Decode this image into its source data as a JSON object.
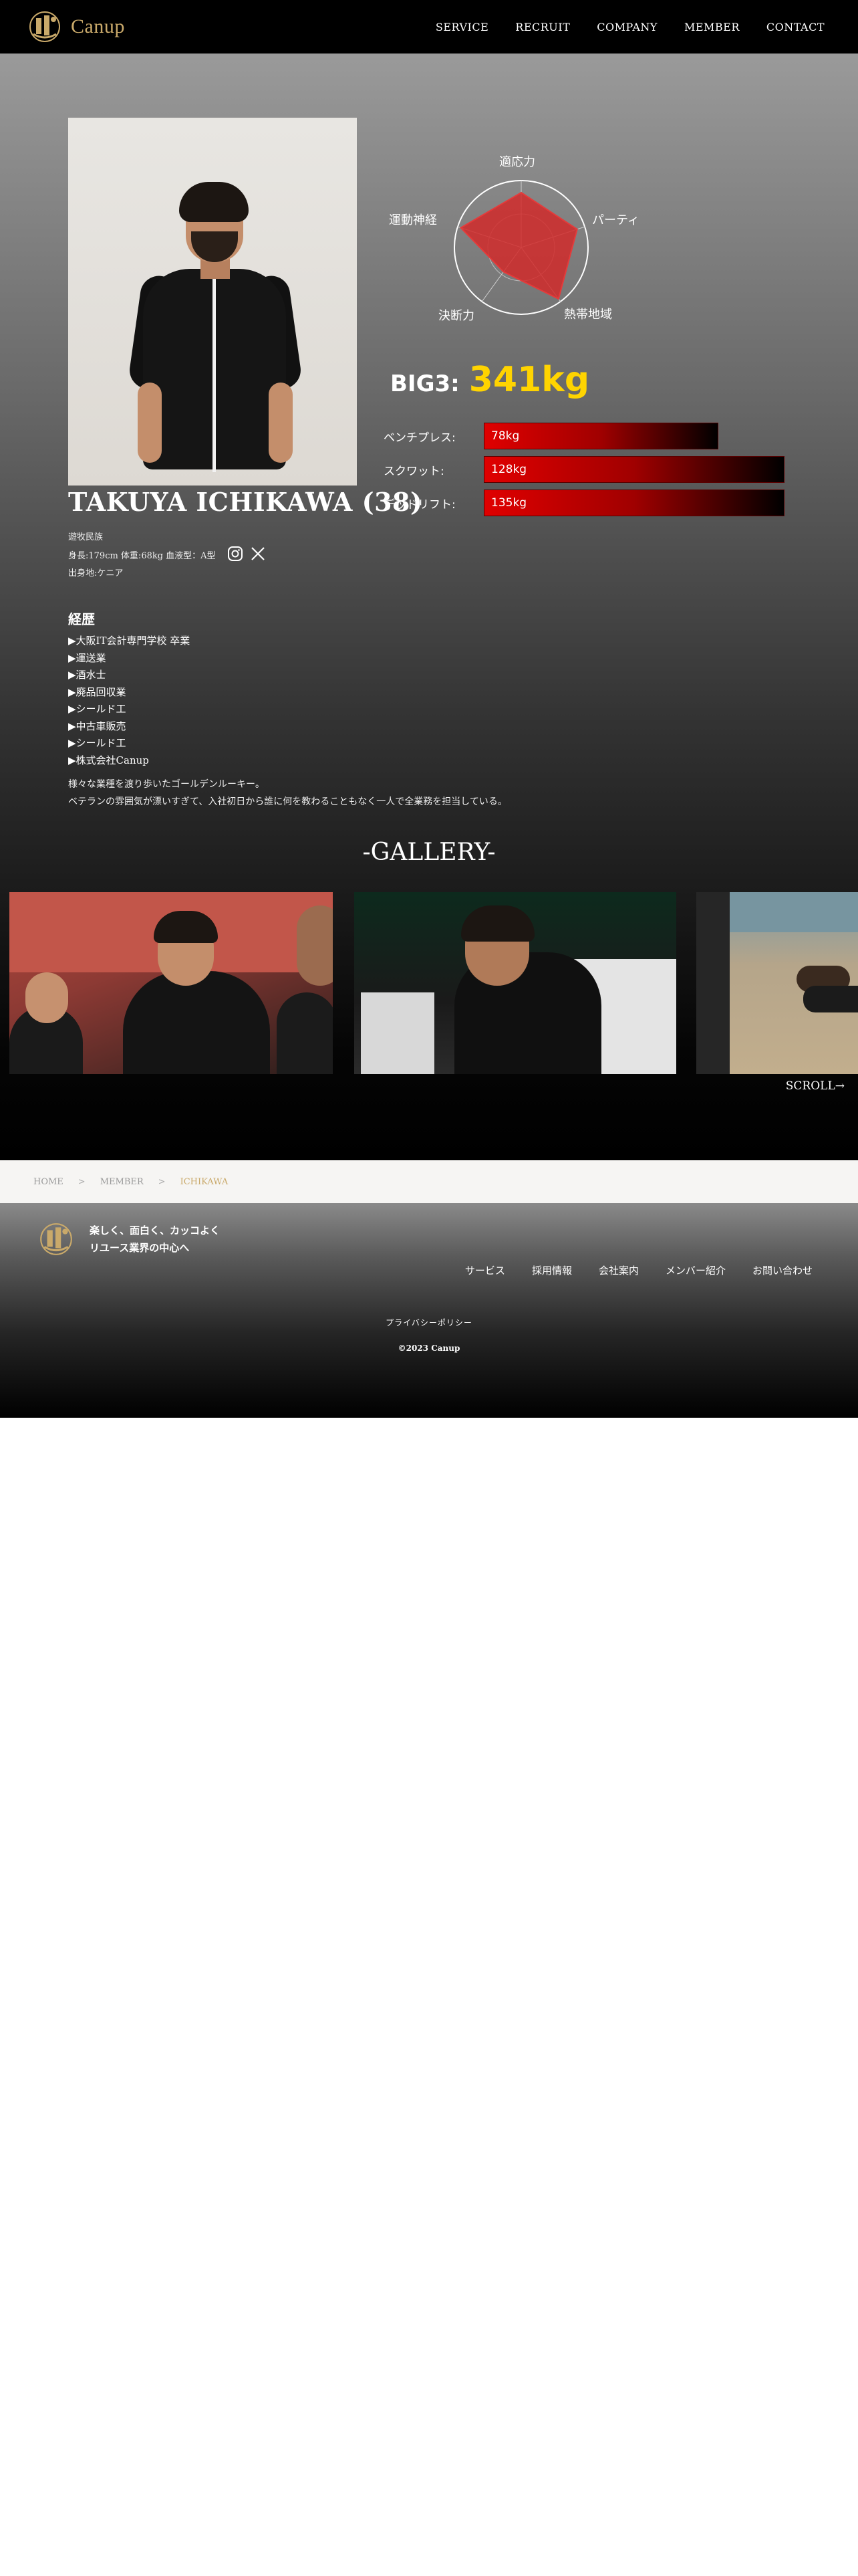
{
  "header": {
    "logo_text": "Canup",
    "nav": [
      "SERVICE",
      "RECRUIT",
      "COMPANY",
      "MEMBER",
      "CONTACT"
    ]
  },
  "profile": {
    "name": "TAKUYA ICHIKAWA (38)",
    "job": "遊牧民族",
    "body_info": "身長:179cm 体重:68kg 血液型：A型",
    "hometown": "出身地:ケニア",
    "sns": [
      "instagram-icon",
      "x-icon"
    ]
  },
  "radar": {
    "labels": [
      "適応力",
      "パーティ",
      "熱帯地域",
      "決断力",
      "運動神経"
    ],
    "values": [
      0.82,
      0.88,
      0.95,
      0.45,
      0.95
    ],
    "fill_color": "#d12a2a"
  },
  "big3": {
    "label": "BIG3:",
    "value": "341kg",
    "value_color": "#ffd400",
    "lifts": [
      {
        "label": "ベンチプレス:",
        "value": "78kg",
        "fraction": 0.78
      },
      {
        "label": "スクワット:",
        "value": "128kg",
        "fraction": 1.0
      },
      {
        "label": "デッドリフト:",
        "value": "135kg",
        "fraction": 1.0
      }
    ]
  },
  "career": {
    "title": "経歴",
    "items": [
      "▶大阪IT会計専門学校 卒業",
      "▶運送業",
      "▶酒水士",
      "▶廃品回収業",
      "▶シールド工",
      "▶中古車販売",
      "▶シールド工",
      "▶株式会社Canup"
    ],
    "description": [
      "様々な業種を渡り歩いたゴールデンルーキー。",
      "ベテランの雰囲気が漂いすぎて、入社初日から誰に何を教わることもなく一人で全業務を担当している。"
    ]
  },
  "gallery": {
    "title": "-GALLERY-",
    "scroll": "SCROLL→"
  },
  "breadcrumb": {
    "items": [
      "HOME",
      "MEMBER",
      "ICHIKAWA"
    ],
    "separator": ">"
  },
  "footer": {
    "tagline": [
      "楽しく、面白く、カッコよく",
      "リユース業界の中心へ"
    ],
    "nav": [
      "サービス",
      "採用情報",
      "会社案内",
      "メンバー紹介",
      "お問い合わせ"
    ],
    "privacy": "プライバシーポリシー",
    "copyright": "©2023 Canup"
  }
}
